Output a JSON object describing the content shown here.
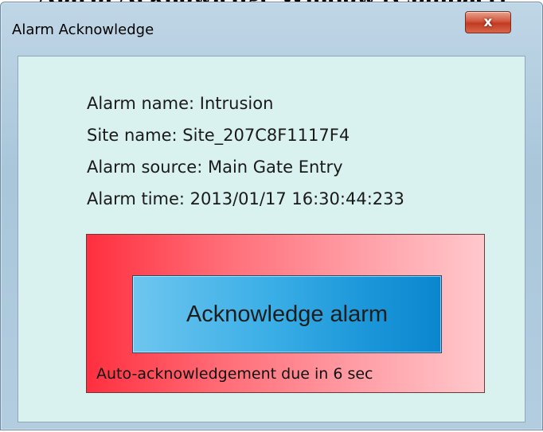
{
  "document": {
    "partial_title": "Alarm Acknowledge Window (Compact)"
  },
  "window": {
    "title": "Alarm Acknowledge",
    "close_glyph": "x"
  },
  "alarm": {
    "name_line": "Alarm name: Intrusion",
    "site_line": "Site name: Site_207C8F1117F4",
    "source_line": "Alarm source: Main Gate Entry",
    "time_line": "Alarm time: 2013/01/17 16:30:44:233"
  },
  "actions": {
    "acknowledge_label": "Acknowledge alarm",
    "countdown_text": "Auto-acknowledgement due in 6 sec"
  }
}
